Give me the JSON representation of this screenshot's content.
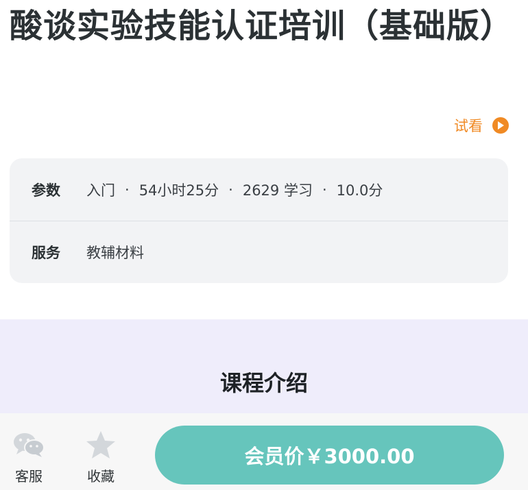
{
  "course": {
    "title": "酸谈实验技能认证培训（基础版）"
  },
  "trial": {
    "label": "试看",
    "icon": "play-circle-icon",
    "color": "#f08a24"
  },
  "info": {
    "params_label": "参数",
    "level": "入门",
    "duration": "54小时25分",
    "learners": "2629 学习",
    "rating": "10.0分",
    "separator": "·",
    "service_label": "服务",
    "service_value": "教辅材料"
  },
  "intro": {
    "title": "课程介绍"
  },
  "bottom_bar": {
    "service_label": "客服",
    "service_icon": "wechat-icon",
    "favorite_label": "收藏",
    "favorite_icon": "star-icon",
    "buy_label": "会员价￥3000.00",
    "buy_color": "#66c5bc"
  }
}
